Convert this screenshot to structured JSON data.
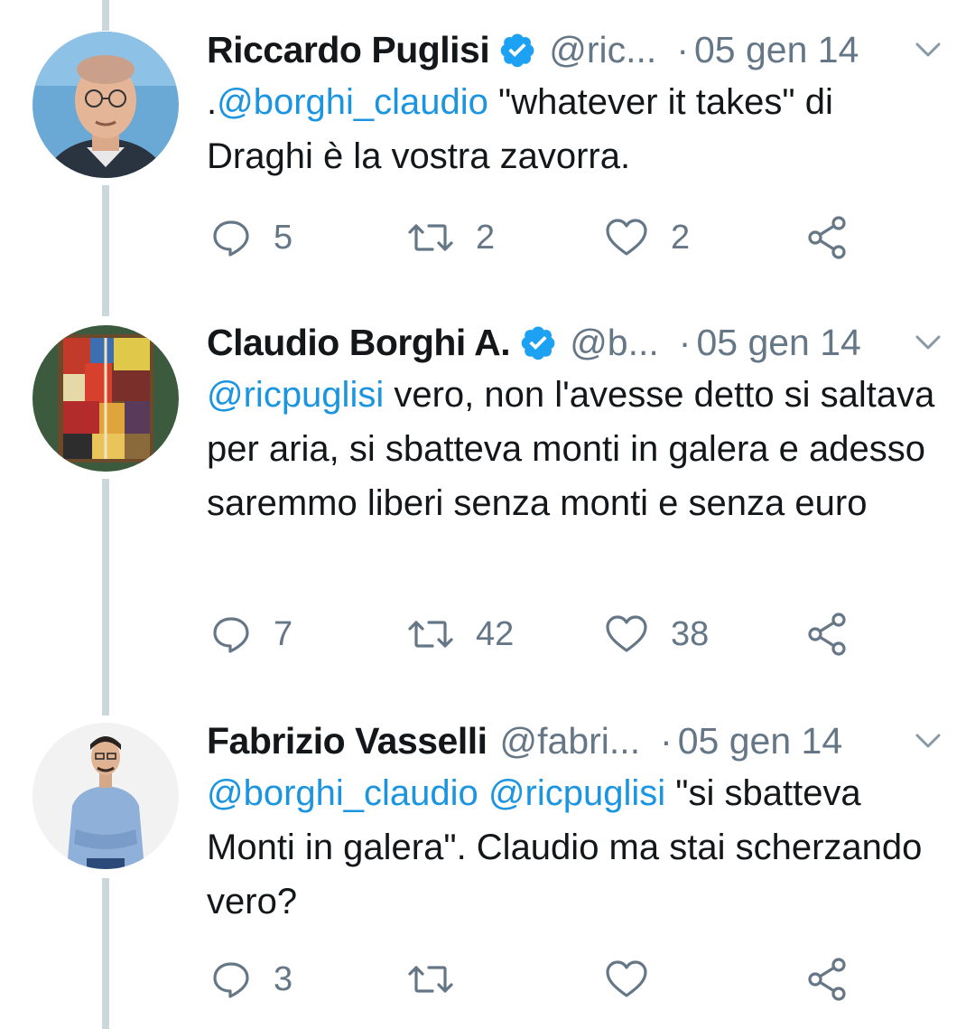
{
  "colors": {
    "mention": "#1b95e0",
    "secondary_text": "#657786",
    "thread_line": "#ccd6dd",
    "verified_badge": "#1da1f2"
  },
  "tweets": [
    {
      "name": "Riccardo Puglisi",
      "verified": true,
      "handle": "@ric...",
      "separator": "·",
      "date": "05 gen 14",
      "text_parts": [
        {
          "type": "text",
          "value": "."
        },
        {
          "type": "mention",
          "value": "@borghi_claudio"
        },
        {
          "type": "text",
          "value": " \"whatever it takes\" di Draghi è la vostra zavorra."
        }
      ],
      "replies": "5",
      "retweets": "2",
      "likes": "2",
      "avatar_icon": "man-with-glasses-photo"
    },
    {
      "name": "Claudio Borghi A.",
      "verified": true,
      "handle": "@b...",
      "separator": "·",
      "date": "05 gen 14",
      "text_parts": [
        {
          "type": "mention",
          "value": "@ricpuglisi"
        },
        {
          "type": "text",
          "value": " vero, non l'avesse detto si saltava per aria, si sbatteva monti in galera e adesso saremmo liberi senza monti e senza euro"
        }
      ],
      "replies": "7",
      "retweets": "42",
      "likes": "38",
      "avatar_icon": "abstract-painting-image"
    },
    {
      "name": "Fabrizio Vasselli",
      "verified": false,
      "handle": "@fabri...",
      "separator": "·",
      "date": "05 gen 14",
      "text_parts": [
        {
          "type": "mention",
          "value": "@borghi_claudio"
        },
        {
          "type": "text",
          "value": " "
        },
        {
          "type": "mention",
          "value": "@ricpuglisi"
        },
        {
          "type": "text",
          "value": " \"si sbatteva Monti in galera\". Claudio ma stai scherzando vero?"
        }
      ],
      "replies": "3",
      "retweets": "",
      "likes": "",
      "avatar_icon": "man-in-blue-shirt-photo"
    }
  ],
  "icons": {
    "reply": "reply-icon",
    "retweet": "retweet-icon",
    "like": "heart-icon",
    "share": "share-icon",
    "more": "chevron-down-icon",
    "verified": "verified-badge-icon"
  }
}
